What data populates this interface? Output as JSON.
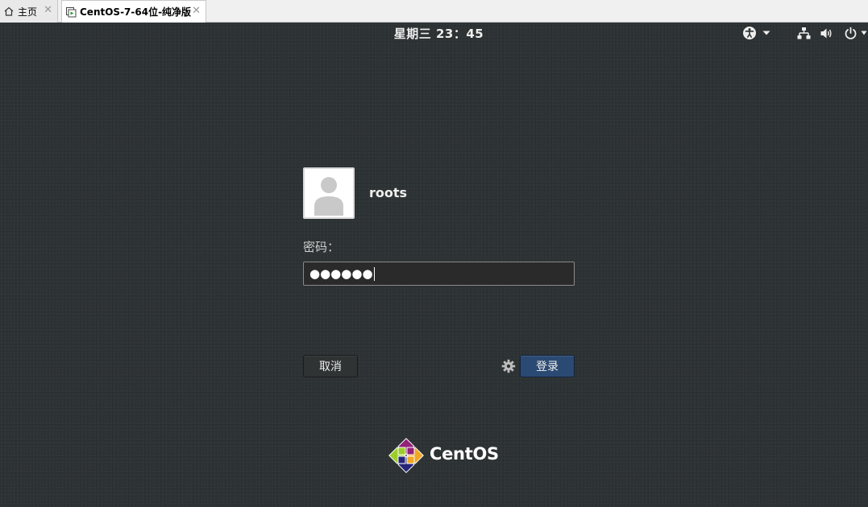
{
  "tabs": [
    {
      "label": "主页",
      "icon": "home-icon",
      "active": false
    },
    {
      "label": "CentOS-7-64位-纯净版",
      "icon": "vm-icon",
      "active": true
    }
  ],
  "topbar": {
    "clock": "星期三 23：45",
    "indicators": [
      "accessibility-icon",
      "chevron-down-icon",
      "network-icon",
      "volume-icon",
      "power-icon"
    ]
  },
  "login": {
    "username": "roots",
    "password_label": "密码：",
    "password_value": "●●●●●●",
    "cancel_label": "取消",
    "login_label": "登录"
  },
  "branding": {
    "logo_text": "CentOS"
  },
  "colors": {
    "background": "#2d3234",
    "login_button": "#2a4a73",
    "cancel_button": "#2f3334"
  }
}
